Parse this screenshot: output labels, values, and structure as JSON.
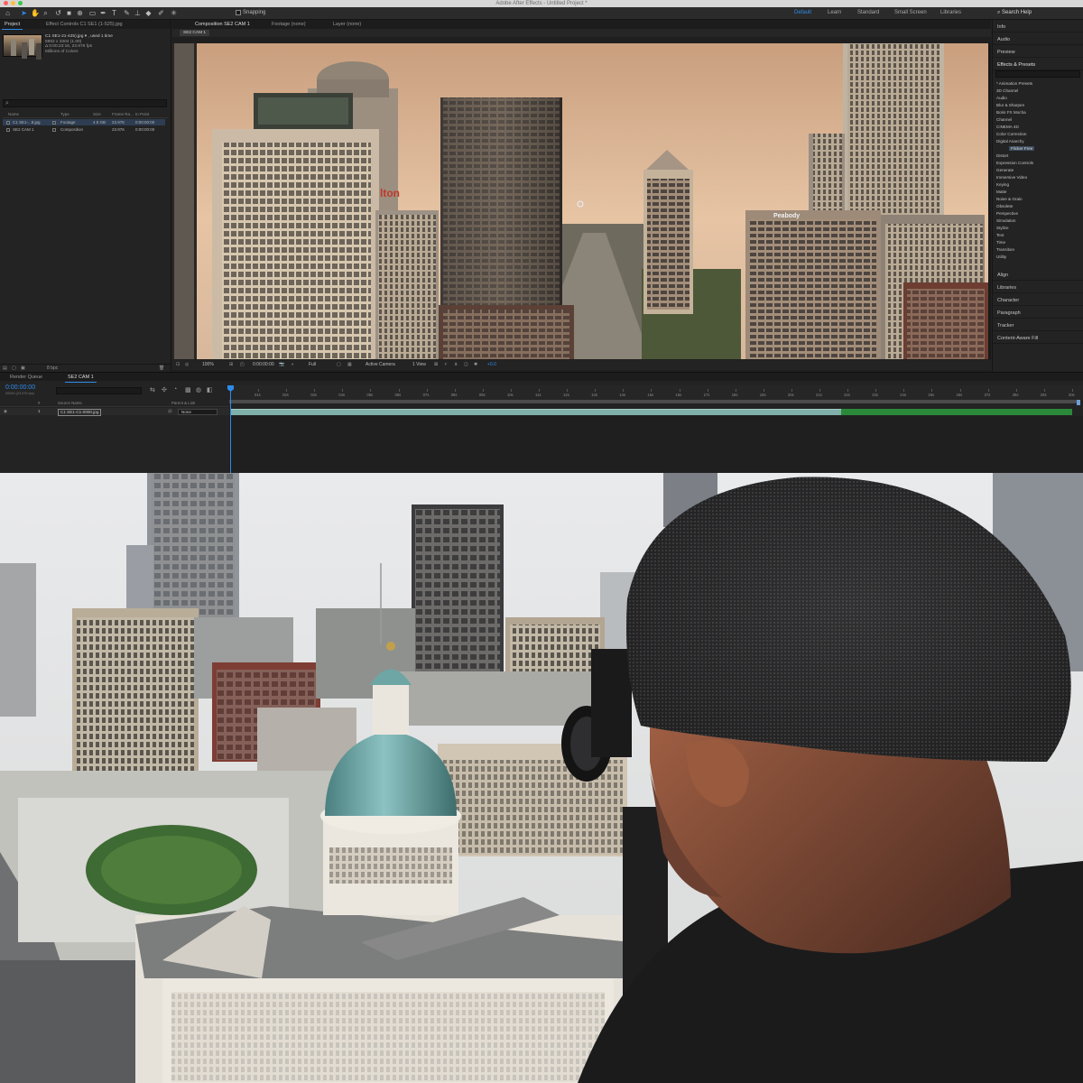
{
  "window": {
    "title": "Adobe After Effects - Untitled Project *"
  },
  "toolbar": {
    "snapping_label": "Snapping",
    "workspaces": [
      {
        "label": "Default",
        "selected": true
      },
      {
        "label": "Learn",
        "selected": false
      },
      {
        "label": "Standard",
        "selected": false
      },
      {
        "label": "Small Screen",
        "selected": false
      },
      {
        "label": "Libraries",
        "selected": false
      }
    ],
    "search_placeholder": "Search Help"
  },
  "project_panel": {
    "tabs": [
      "Project",
      "Effect Controls C1 SE1 (1-525).jpg"
    ],
    "selected_item": {
      "name": "C1 SE1-21-425).jpg ▾ , used 1 time",
      "dimensions": "5952 x 3304 (1.00)",
      "duration": "Δ 0:00:23:16, 23.976 fps",
      "colors": "Millions of Colors"
    },
    "columns": [
      "Name",
      "Type",
      "Size",
      "Frame Ra...",
      "In Point"
    ],
    "items": [
      {
        "name": "C1 SE1-...8.jpg",
        "type": "Footage",
        "size": "4.5 GB",
        "fps": "23.976",
        "in": "0:00:00:00",
        "selected": true
      },
      {
        "name": "SE2 CAM 1",
        "type": "Composition",
        "size": "",
        "fps": "23.976",
        "in": "0:00:00:00",
        "selected": false
      }
    ],
    "bpc": "8 bpc"
  },
  "composition_panel": {
    "tabs": [
      "Composition SE2 CAM 1",
      "Footage (none)",
      "Layer (none)"
    ],
    "breadcrumb": "SE2 CAM 1",
    "viewer_bar": {
      "zoom": "100%",
      "timecode": "0:00:00:00",
      "resolution": "Full",
      "camera": "Active Camera",
      "views": "1 View",
      "exposure": "+0.0"
    }
  },
  "right_panel": {
    "top_sections": [
      "Info",
      "Audio",
      "Preview"
    ],
    "effects_title": "Effects & Presets",
    "effects": [
      "* Animation Presets",
      "3D Channel",
      "Audio",
      "Blur & Sharpen",
      "Boris FX Mocha",
      "Channel",
      "CINEMA 4D",
      "Color Correction",
      "Digital Anarchy"
    ],
    "effects_child": "Flicker Free",
    "effects_after": [
      "Distort",
      "Expression Controls",
      "Generate",
      "Immersive Video",
      "Keying",
      "Matte",
      "Noise & Grain",
      "Obsolete",
      "Perspective",
      "Simulation",
      "Stylize",
      "Text",
      "Time",
      "Transition",
      "Utility"
    ],
    "bottom_sections": [
      "Align",
      "Libraries",
      "Character",
      "Paragraph",
      "Tracker",
      "Content-Aware Fill"
    ]
  },
  "timeline": {
    "tabs": [
      "Render Queue",
      "SE2 CAM 1"
    ],
    "timecode": "0:00:00:00",
    "timecode_sub": "00000 (23.976 fps)",
    "layer_columns": [
      "#",
      "Source Name",
      "Parent & Link"
    ],
    "layer": {
      "index": "1",
      "name": "C1 SE1-C1-0000.jpg",
      "parent": "None"
    },
    "ruler_ticks": [
      "01s",
      "02s",
      "03s",
      "04s",
      "05s",
      "06s",
      "07s",
      "08s",
      "09s",
      "10s",
      "11s",
      "12s",
      "13s",
      "14s",
      "15s",
      "16s",
      "17s",
      "18s",
      "19s",
      "20s",
      "21s",
      "22s",
      "23s",
      "24s",
      "25s",
      "26s",
      "27s",
      "28s",
      "29s",
      "30s"
    ]
  },
  "colors": {
    "accent": "#2d8ceb",
    "panel_bg": "#232323",
    "layer_bar": "#7fb0a9",
    "layer_bar_end": "#2a8a3a"
  },
  "icons": [
    "home-icon",
    "selection-tool-icon",
    "hand-tool-icon",
    "zoom-tool-icon",
    "camera-tool-icon",
    "pen-tool-icon",
    "text-tool-icon",
    "brush-tool-icon",
    "puppet-tool-icon",
    "search-icon"
  ]
}
